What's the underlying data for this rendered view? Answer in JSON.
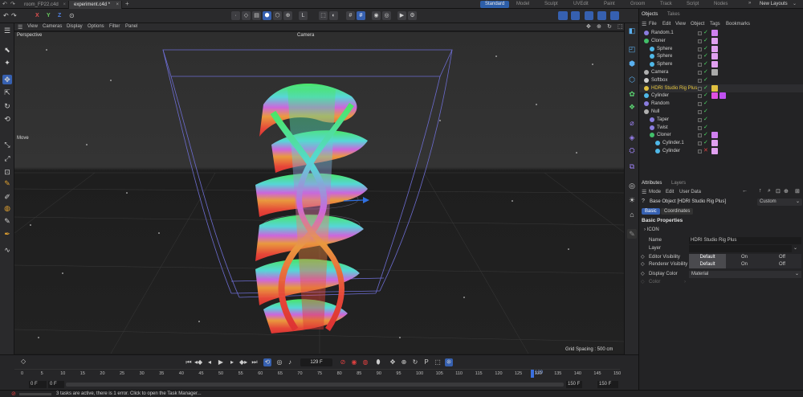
{
  "file_tabs": [
    "room_FP22.c4d",
    "experiment.c4d *"
  ],
  "layouts": [
    "Standard",
    "Model",
    "Sculpt",
    "UVEdit",
    "Paint",
    "Groom",
    "Track",
    "Script",
    "Nodes"
  ],
  "active_layout": "Standard",
  "new_layouts_label": "New Layouts",
  "axes": [
    "X",
    "Y",
    "Z"
  ],
  "viewport_menu": [
    "View",
    "Cameras",
    "Display",
    "Options",
    "Filter",
    "Panel"
  ],
  "viewport": {
    "label": "Perspective",
    "camera": "Camera",
    "grid_spacing": "Grid Spacing : 500 cm",
    "tool_tip": "Move"
  },
  "timeline": {
    "current_frame": "129 F",
    "ticks": [
      "0",
      "5",
      "10",
      "15",
      "20",
      "25",
      "30",
      "35",
      "40",
      "45",
      "50",
      "55",
      "60",
      "65",
      "70",
      "75",
      "80",
      "85",
      "90",
      "95",
      "100",
      "105",
      "110",
      "115",
      "120",
      "125",
      "130",
      "135",
      "140",
      "145",
      "150"
    ],
    "playhead_label": "129",
    "start_field": "0 F",
    "start_field2": "0 F",
    "end_field": "150 F",
    "end_field2": "150 F"
  },
  "status_text": "3 tasks are active, there is 1 error. Click to open the Task Manager...",
  "objects_panel": {
    "tabs": [
      "Objects",
      "Takes"
    ],
    "menu": [
      "File",
      "Edit",
      "View",
      "Object",
      "Tags",
      "Bookmarks"
    ],
    "rows": [
      {
        "name": "Random.1",
        "indent": 0,
        "color": "#8a7de0"
      },
      {
        "name": "Cloner",
        "indent": 0,
        "color": "#42c06a"
      },
      {
        "name": "Sphere",
        "indent": 1,
        "color": "#4fb8e8"
      },
      {
        "name": "Sphere",
        "indent": 1,
        "color": "#4fb8e8"
      },
      {
        "name": "Sphere",
        "indent": 1,
        "color": "#4fb8e8"
      },
      {
        "name": "Camera",
        "indent": 0,
        "color": "#b0b0b0"
      },
      {
        "name": "Softbox",
        "indent": 0,
        "color": "#d0d0d0"
      },
      {
        "name": "HDRI Studio Rig Plus",
        "indent": 0,
        "color": "#e0c040",
        "highlight": true
      },
      {
        "name": "Cylinder",
        "indent": 0,
        "color": "#4fb8e8"
      },
      {
        "name": "Random",
        "indent": 0,
        "color": "#8a7de0"
      },
      {
        "name": "Null",
        "indent": 0,
        "color": "#b0b0b0"
      },
      {
        "name": "Taper",
        "indent": 1,
        "color": "#8a7de0"
      },
      {
        "name": "Twist",
        "indent": 1,
        "color": "#8a7de0"
      },
      {
        "name": "Cloner",
        "indent": 1,
        "color": "#42c06a"
      },
      {
        "name": "Cylinder.1",
        "indent": 2,
        "color": "#4fb8e8"
      },
      {
        "name": "Cylinder",
        "indent": 2,
        "color": "#4fb8e8"
      }
    ]
  },
  "attributes_panel": {
    "tabs": [
      "Attributes",
      "Layers"
    ],
    "menu": [
      "Mode",
      "Edit",
      "User Data"
    ],
    "object_title": "Base Object [HDRI Studio Rig Plus]",
    "preset": "Custom",
    "subtabs": [
      "Basic",
      "Coordinates"
    ],
    "section": "Basic Properties",
    "group": "ICON",
    "fields": {
      "name_label": "Name",
      "name_value": "HDRI Studio Rig Plus",
      "layer_label": "Layer",
      "editor_vis_label": "Editor Visibility",
      "renderer_vis_label": "Renderer Visibility",
      "vis_options": [
        "Default",
        "On",
        "Off"
      ],
      "display_color_label": "Display Color",
      "display_color_value": "Material",
      "color_label": "Color"
    }
  },
  "colors": {
    "accent": "#3660b0",
    "check": "#4cd964",
    "error": "#e04040"
  }
}
